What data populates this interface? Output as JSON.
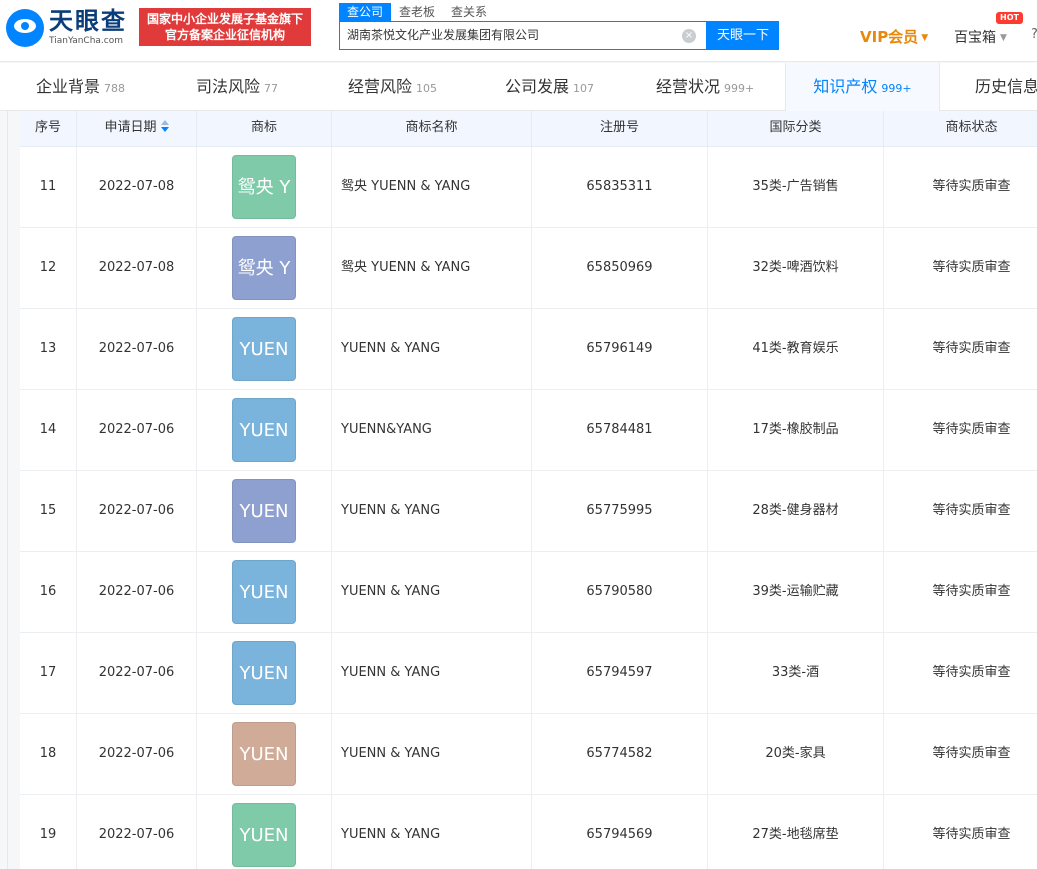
{
  "header": {
    "logo_title": "天眼查",
    "logo_sub": "TianYanCha.com",
    "slogan_line1": "国家中小企业发展子基金旗下",
    "slogan_line2": "官方备案企业征信机构",
    "search_tabs": [
      "查公司",
      "查老板",
      "查关系"
    ],
    "search_value": "湖南茶悦文化产业发展集团有限公司",
    "clear_glyph": "×",
    "search_button": "天眼一下",
    "vip_label": "VIP会员",
    "vip_arrow": "▼",
    "baobox_label": "百宝箱",
    "baobox_arrow": "▼",
    "hot_badge": "HOT",
    "edge_char": "?"
  },
  "nav": [
    {
      "label": "企业背景",
      "count": "788"
    },
    {
      "label": "司法风险",
      "count": "77"
    },
    {
      "label": "经营风险",
      "count": "105"
    },
    {
      "label": "公司发展",
      "count": "107"
    },
    {
      "label": "经营状况",
      "count": "999+"
    },
    {
      "label": "知识产权",
      "count": "999+",
      "active": true
    },
    {
      "label": "历史信息",
      "count": ""
    }
  ],
  "table": {
    "headers": [
      "序号",
      "申请日期",
      "商标",
      "商标名称",
      "注册号",
      "国际分类",
      "商标状态"
    ],
    "rows": [
      {
        "no": "11",
        "date": "2022-07-08",
        "mark": "鸳央 Y",
        "mark_color": "#7fcaa9",
        "name": "鸳央 YUENN & YANG",
        "reg": "65835311",
        "cls": "35类-广告销售",
        "status": "等待实质审查"
      },
      {
        "no": "12",
        "date": "2022-07-08",
        "mark": "鸳央 Y",
        "mark_color": "#8ea0cf",
        "name": "鸳央 YUENN & YANG",
        "reg": "65850969",
        "cls": "32类-啤酒饮料",
        "status": "等待实质审查"
      },
      {
        "no": "13",
        "date": "2022-07-06",
        "mark": "YUEN",
        "mark_color": "#7ab3dc",
        "name": "YUENN & YANG",
        "reg": "65796149",
        "cls": "41类-教育娱乐",
        "status": "等待实质审查"
      },
      {
        "no": "14",
        "date": "2022-07-06",
        "mark": "YUEN",
        "mark_color": "#7ab3dc",
        "name": "YUENN&YANG",
        "reg": "65784481",
        "cls": "17类-橡胶制品",
        "status": "等待实质审查"
      },
      {
        "no": "15",
        "date": "2022-07-06",
        "mark": "YUEN",
        "mark_color": "#8ea0cf",
        "name": "YUENN & YANG",
        "reg": "65775995",
        "cls": "28类-健身器材",
        "status": "等待实质审查"
      },
      {
        "no": "16",
        "date": "2022-07-06",
        "mark": "YUEN",
        "mark_color": "#7ab3dc",
        "name": "YUENN & YANG",
        "reg": "65790580",
        "cls": "39类-运输贮藏",
        "status": "等待实质审查"
      },
      {
        "no": "17",
        "date": "2022-07-06",
        "mark": "YUEN",
        "mark_color": "#7ab3dc",
        "name": "YUENN & YANG",
        "reg": "65794597",
        "cls": "33类-酒",
        "status": "等待实质审查"
      },
      {
        "no": "18",
        "date": "2022-07-06",
        "mark": "YUEN",
        "mark_color": "#cfab98",
        "name": "YUENN & YANG",
        "reg": "65774582",
        "cls": "20类-家具",
        "status": "等待实质审查"
      },
      {
        "no": "19",
        "date": "2022-07-06",
        "mark": "YUEN",
        "mark_color": "#7fcaa9",
        "name": "YUENN & YANG",
        "reg": "65794569",
        "cls": "27类-地毯席垫",
        "status": "等待实质审查"
      }
    ]
  }
}
